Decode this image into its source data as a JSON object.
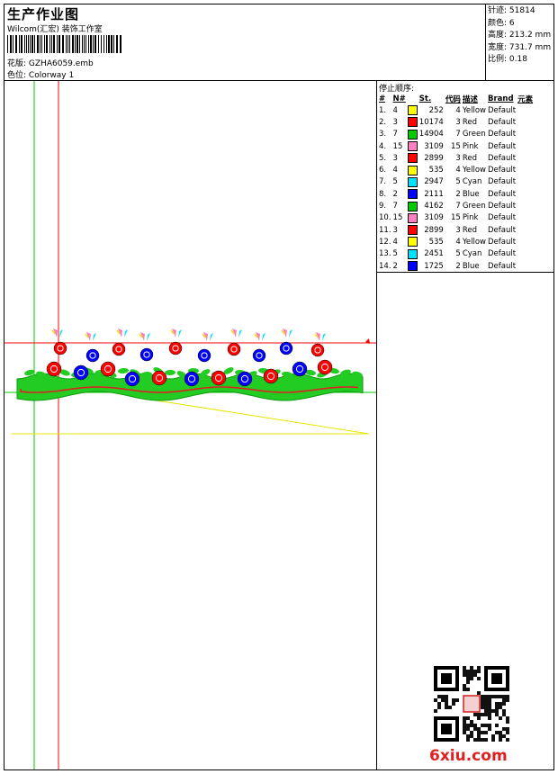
{
  "header": {
    "title": "生产作业图",
    "studio": "Wilcom(汇宏) 装饰工作室",
    "design_label": "花版:",
    "design_value": "GZHA6059.emb",
    "colorway_label": "色位:",
    "colorway_value": "Colorway 1"
  },
  "stats": [
    {
      "label": "针迹:",
      "value": "51814"
    },
    {
      "label": "颜色:",
      "value": "6"
    },
    {
      "label": "高度:",
      "value": "213.2 mm"
    },
    {
      "label": "宽度:",
      "value": "731.7 mm"
    },
    {
      "label": "比例:",
      "value": "0.18"
    }
  ],
  "stop_sequence": {
    "title": "停止顺序:",
    "headers": [
      "#",
      "N#",
      "St.",
      "代码",
      "描述",
      "Brand",
      "元素"
    ],
    "rows": [
      {
        "idx": "1.",
        "n": "4",
        "color": "#ffff00",
        "st": "252",
        "code": "4",
        "desc": "Yellow",
        "brand": "Default"
      },
      {
        "idx": "2.",
        "n": "3",
        "color": "#ff0000",
        "st": "10174",
        "code": "3",
        "desc": "Red",
        "brand": "Default"
      },
      {
        "idx": "3.",
        "n": "7",
        "color": "#00cc00",
        "st": "14904",
        "code": "7",
        "desc": "Green",
        "brand": "Default"
      },
      {
        "idx": "4.",
        "n": "15",
        "color": "#ff80c0",
        "st": "3109",
        "code": "15",
        "desc": "Pink",
        "brand": "Default"
      },
      {
        "idx": "5.",
        "n": "3",
        "color": "#ff0000",
        "st": "2899",
        "code": "3",
        "desc": "Red",
        "brand": "Default"
      },
      {
        "idx": "6.",
        "n": "4",
        "color": "#ffff00",
        "st": "535",
        "code": "4",
        "desc": "Yellow",
        "brand": "Default"
      },
      {
        "idx": "7.",
        "n": "5",
        "color": "#00e0ff",
        "st": "2947",
        "code": "5",
        "desc": "Cyan",
        "brand": "Default"
      },
      {
        "idx": "8.",
        "n": "2",
        "color": "#0000ff",
        "st": "2111",
        "code": "2",
        "desc": "Blue",
        "brand": "Default"
      },
      {
        "idx": "9.",
        "n": "7",
        "color": "#00cc00",
        "st": "4162",
        "code": "7",
        "desc": "Green",
        "brand": "Default"
      },
      {
        "idx": "10.",
        "n": "15",
        "color": "#ff80c0",
        "st": "3109",
        "code": "15",
        "desc": "Pink",
        "brand": "Default"
      },
      {
        "idx": "11.",
        "n": "3",
        "color": "#ff0000",
        "st": "2899",
        "code": "3",
        "desc": "Red",
        "brand": "Default"
      },
      {
        "idx": "12.",
        "n": "4",
        "color": "#ffff00",
        "st": "535",
        "code": "4",
        "desc": "Yellow",
        "brand": "Default"
      },
      {
        "idx": "13.",
        "n": "5",
        "color": "#00e0ff",
        "st": "2451",
        "code": "5",
        "desc": "Cyan",
        "brand": "Default"
      },
      {
        "idx": "14.",
        "n": "2",
        "color": "#0000ff",
        "st": "1725",
        "code": "2",
        "desc": "Blue",
        "brand": "Default"
      }
    ]
  },
  "watermark": "6xiu.com",
  "guide_colors": {
    "red": "#ff0000",
    "green": "#00cc00",
    "yellow": "#e6e600"
  }
}
